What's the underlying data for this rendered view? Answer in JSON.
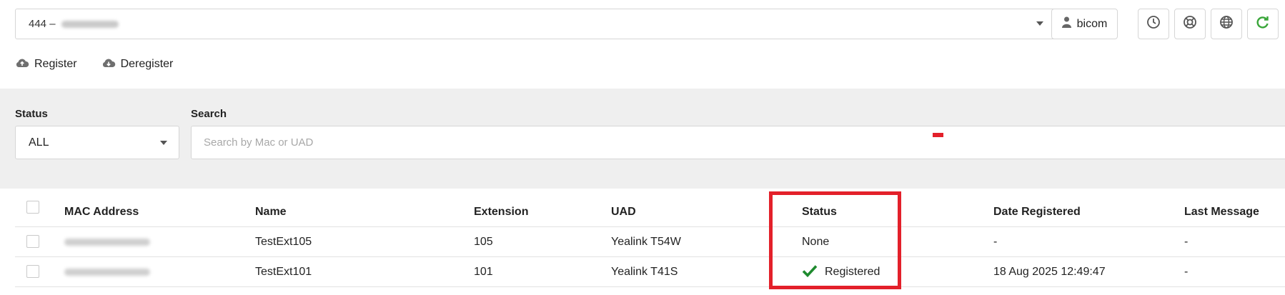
{
  "header": {
    "tenant_value": "444 –",
    "user_label": "bicom",
    "icons": [
      "clock-icon",
      "lifebuoy-icon",
      "globe-icon",
      "refresh-icon"
    ],
    "accent_green": "#3aa63a"
  },
  "actions": {
    "register_label": "Register",
    "deregister_label": "Deregister"
  },
  "filters": {
    "status_label": "Status",
    "status_value": "ALL",
    "search_label": "Search",
    "search_placeholder": "Search by Mac or UAD"
  },
  "table": {
    "columns": [
      "MAC Address",
      "Name",
      "Extension",
      "UAD",
      "Status",
      "Date Registered",
      "Last Message"
    ],
    "rows": [
      {
        "name": "TestExt105",
        "extension": "105",
        "uad": "Yealink T54W",
        "status": "None",
        "date_registered": "-",
        "last_message": "-"
      },
      {
        "name": "TestExt101",
        "extension": "101",
        "uad": "Yealink T41S",
        "status": "Registered",
        "date_registered": "18 Aug 2025 12:49:47",
        "last_message": "-"
      }
    ]
  },
  "highlight_color": "#e3202a"
}
